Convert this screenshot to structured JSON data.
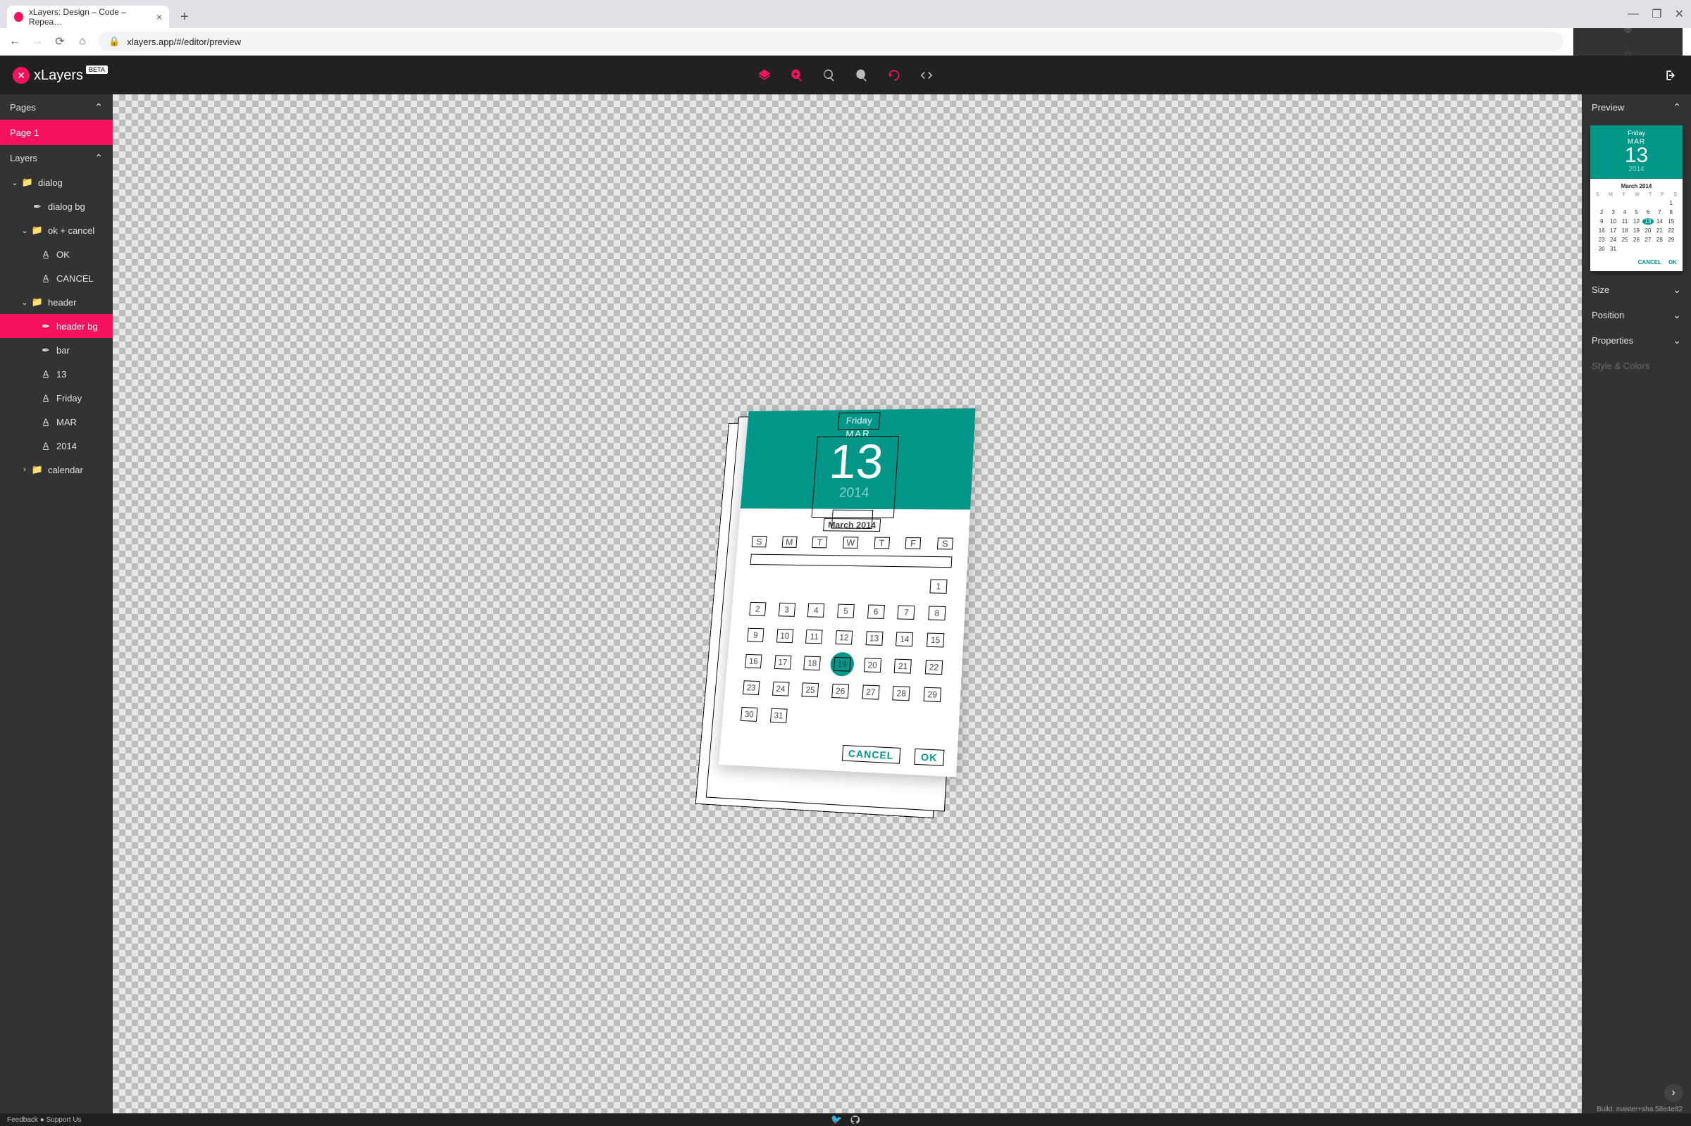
{
  "browser": {
    "tab_title": "xLayers: Design – Code – Repea…",
    "url": "xlayers.app/#/editor/preview"
  },
  "app": {
    "brand": "xLayers",
    "beta": "BETA",
    "build": "Build: master+sha.58e4e82"
  },
  "footer": {
    "left": "Feedback ● Support Us"
  },
  "left_panel": {
    "pages_title": "Pages",
    "page1": "Page 1",
    "layers_title": "Layers",
    "tree": [
      {
        "d": 1,
        "ic": "folder",
        "arrow": "down",
        "label": "dialog"
      },
      {
        "d": 2,
        "ic": "shape",
        "label": "dialog bg"
      },
      {
        "d": 2,
        "ic": "folder",
        "arrow": "down",
        "label": "ok + cancel"
      },
      {
        "d": 3,
        "ic": "text",
        "label": "OK"
      },
      {
        "d": 3,
        "ic": "text",
        "label": "CANCEL"
      },
      {
        "d": 2,
        "ic": "folder",
        "arrow": "down",
        "label": "header"
      },
      {
        "d": 3,
        "ic": "shape",
        "label": "header bg",
        "sel": true
      },
      {
        "d": 3,
        "ic": "shape",
        "label": "bar"
      },
      {
        "d": 3,
        "ic": "text",
        "label": "13"
      },
      {
        "d": 3,
        "ic": "text",
        "label": "Friday"
      },
      {
        "d": 3,
        "ic": "text",
        "label": "MAR"
      },
      {
        "d": 3,
        "ic": "text",
        "label": "2014"
      },
      {
        "d": 2,
        "ic": "folder",
        "arrow": "right",
        "label": "calendar"
      }
    ]
  },
  "right_panel": {
    "preview_title": "Preview",
    "size": "Size",
    "position": "Position",
    "properties": "Properties",
    "style": "Style & Colors"
  },
  "design": {
    "friday": "Friday",
    "month": "MAR",
    "day13": "13",
    "year": "2014",
    "cal_title": "March 2014",
    "dow": [
      "S",
      "M",
      "T",
      "W",
      "T",
      "F",
      "S"
    ],
    "days": [
      "",
      "",
      "",
      "",
      "",
      "",
      "1",
      "2",
      "3",
      "4",
      "5",
      "6",
      "7",
      "8",
      "9",
      "10",
      "11",
      "12",
      "13",
      "14",
      "15",
      "16",
      "17",
      "18",
      "19",
      "20",
      "21",
      "22",
      "23",
      "24",
      "25",
      "26",
      "27",
      "28",
      "29",
      "30",
      "31"
    ],
    "cancel": "CANCEL",
    "ok": "OK"
  }
}
